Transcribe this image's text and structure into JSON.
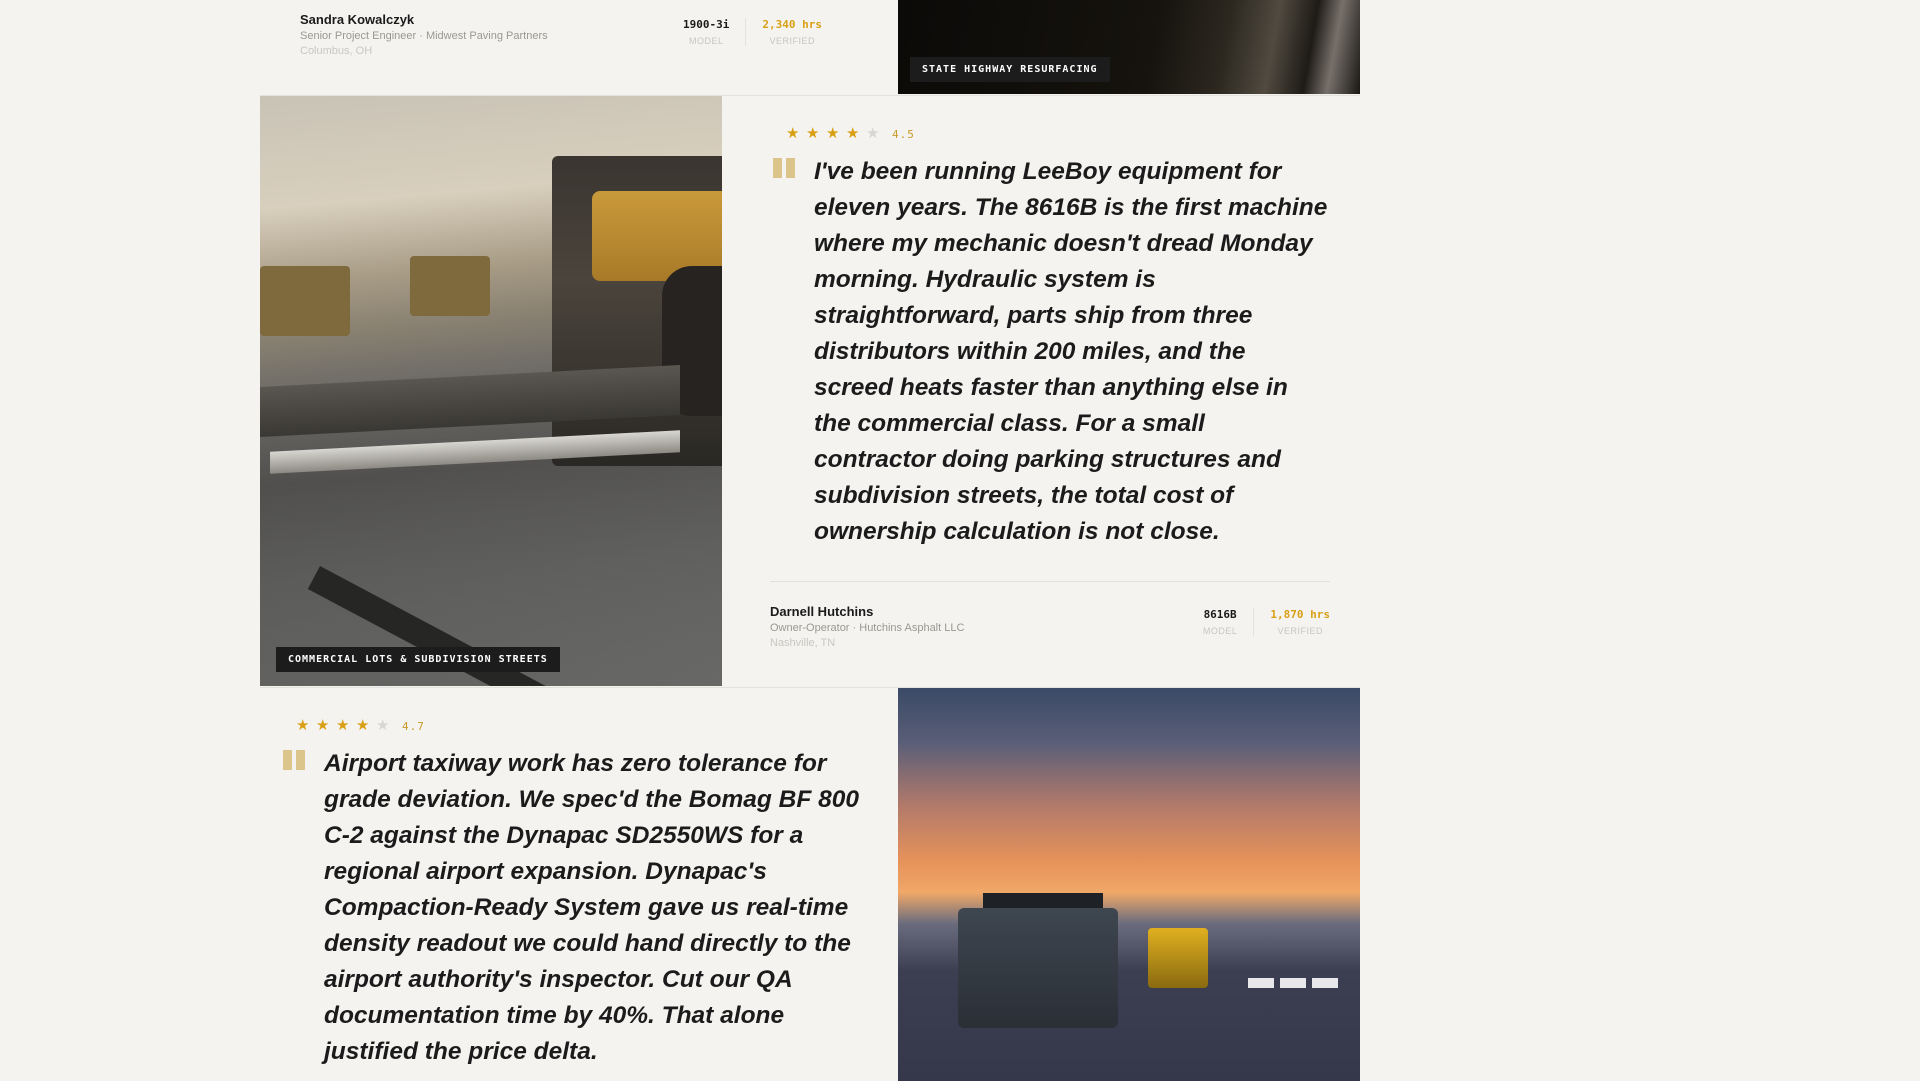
{
  "colors": {
    "accent": "#d9a016",
    "background": "#f4f3f0",
    "tag_background": "#1c1c1c"
  },
  "testimonials": [
    {
      "author": "Sandra Kowalczyk",
      "role": "Senior Project Engineer · Midwest Paving Partners",
      "location": "Columbus, OH",
      "model": "1900-3i",
      "model_label": "MODEL",
      "hours": "2,340 hrs",
      "hours_label": "VERIFIED",
      "photo_tag": "STATE HIGHWAY RESURFACING"
    },
    {
      "rating": 4.5,
      "rating_text": "4.5",
      "stars_filled": 4,
      "stars_total": 5,
      "quote": "I've been running LeeBoy equipment for eleven years. The 8616B is the first machine where my mechanic doesn't dread Monday morning. Hydraulic system is straightforward, parts ship from three distributors within 200 miles, and the screed heats faster than anything else in the commercial class. For a small contractor doing parking structures and subdivision streets, the total cost of ownership calculation is not close.",
      "author": "Darnell Hutchins",
      "role": "Owner-Operator · Hutchins Asphalt LLC",
      "location": "Nashville, TN",
      "model": "8616B",
      "model_label": "MODEL",
      "hours": "1,870 hrs",
      "hours_label": "VERIFIED",
      "photo_tag": "COMMERCIAL LOTS & SUBDIVISION STREETS"
    },
    {
      "rating": 4.7,
      "rating_text": "4.7",
      "stars_filled": 4,
      "stars_total": 5,
      "quote": "Airport taxiway work has zero tolerance for grade deviation. We spec'd the Bomag BF 800 C-2 against the Dynapac SD2550WS for a regional airport expansion. Dynapac's Compaction-Ready System gave us real-time density readout we could hand directly to the airport authority's inspector. Cut our QA documentation time by 40%. That alone justified the price delta."
    }
  ],
  "icons": {
    "star": "star-icon",
    "quote": "quote-mark-icon"
  }
}
